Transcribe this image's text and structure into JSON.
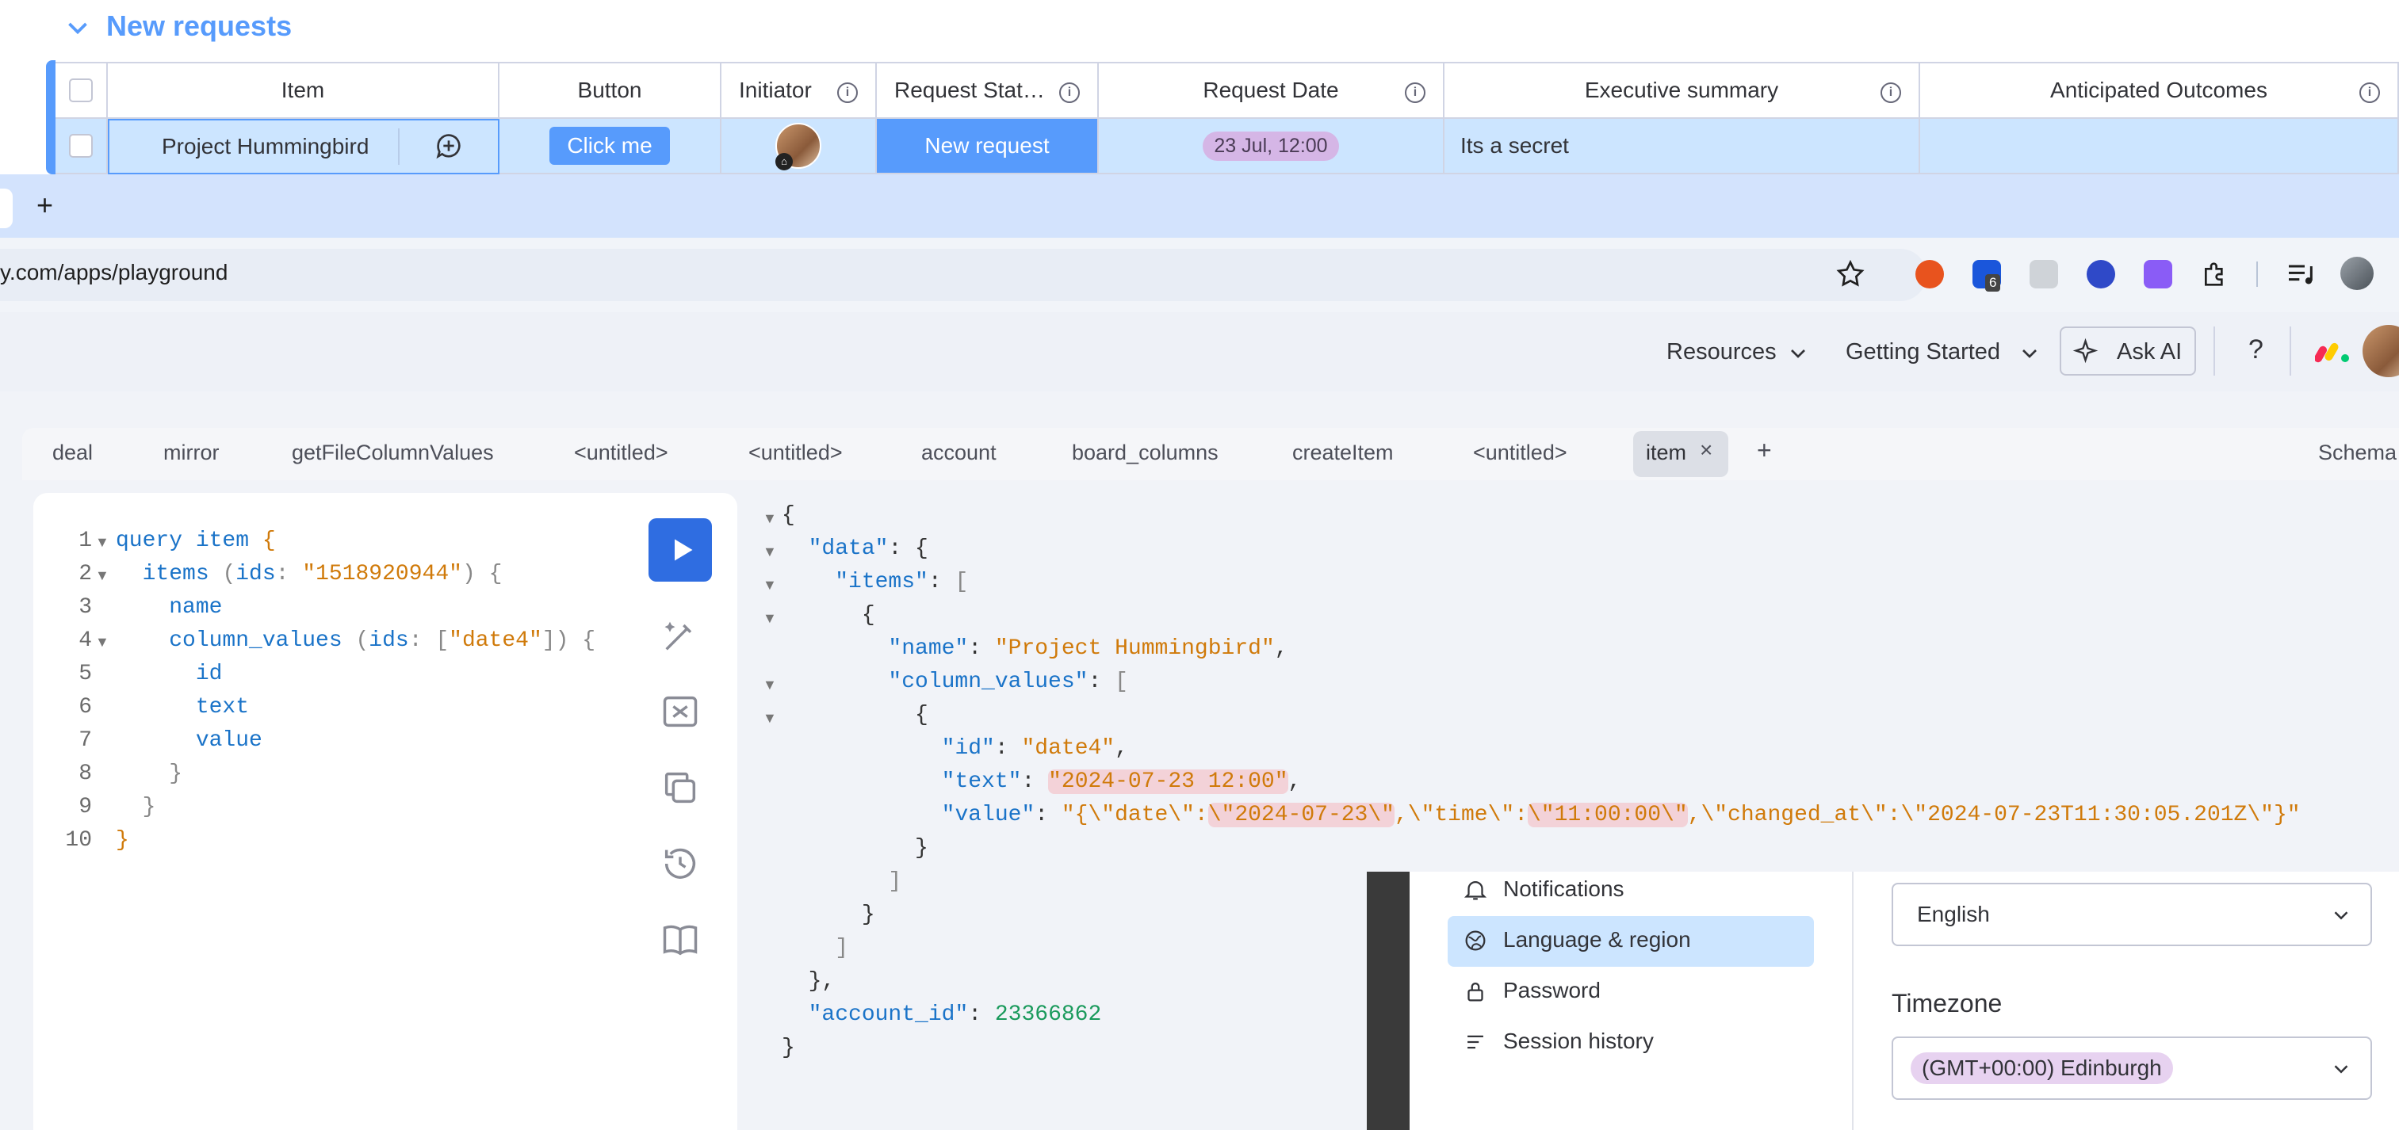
{
  "board": {
    "group_title": "New requests",
    "columns": [
      "Item",
      "Button",
      "Initiator",
      "Request Stat…",
      "Request Date",
      "Executive summary",
      "Anticipated Outcomes"
    ],
    "row": {
      "item": "Project Hummingbird",
      "button": "Click me",
      "status": "New request",
      "date": "23 Jul, 12:00",
      "summary": "Its a secret",
      "outcomes": ""
    }
  },
  "browser": {
    "new_tab": "+",
    "url": "y.com/apps/playground",
    "extension_badge": "6"
  },
  "topbar": {
    "resources": "Resources",
    "getting_started": "Getting Started",
    "ask_ai": "Ask AI",
    "help": "?"
  },
  "query_tabs": [
    "deal",
    "mirror",
    "getFileColumnValues",
    "<untitled>",
    "<untitled>",
    "account",
    "board_columns",
    "createItem",
    "<untitled>",
    "item"
  ],
  "query_tabs_add": "+",
  "schema_label": "Schema",
  "editor": {
    "line_numbers": [
      "1",
      "2",
      "3",
      "4",
      "5",
      "6",
      "7",
      "8",
      "9",
      "10"
    ]
  },
  "result": {
    "name": "Project Hummingbird",
    "id": "date4",
    "text": "2024-07-23 12:00",
    "value_date": "2024-07-23",
    "value_time": "11:00:00",
    "changed_at": "2024-07-23T11:30:05.201Z",
    "account_id": "23366862"
  },
  "settings": {
    "menu": [
      "Notifications",
      "Language & region",
      "Password",
      "Session history"
    ],
    "language": "English",
    "timezone_label": "Timezone",
    "timezone": "(GMT+00:00) Edinburgh"
  }
}
